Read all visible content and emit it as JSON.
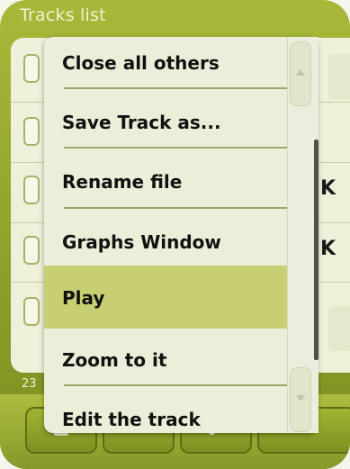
{
  "window": {
    "title": "Tracks list",
    "footer_count": "23",
    "right_text_1": "K",
    "right_text_2": "K"
  },
  "context_menu": {
    "items": [
      {
        "label": "Close all others",
        "selected": false
      },
      {
        "label": "Save Track as...",
        "selected": false
      },
      {
        "label": "Rename file",
        "selected": false
      },
      {
        "label": "Graphs Window",
        "selected": false
      },
      {
        "label": "Play",
        "selected": true
      },
      {
        "label": "Zoom to it",
        "selected": false
      },
      {
        "label": "Edit the track",
        "selected": false
      }
    ]
  },
  "toolbar": {
    "buttons": [
      {
        "icon": "list-icon"
      },
      {
        "icon": "menu-icon"
      },
      {
        "icon": "edit-pencil-icon"
      },
      {
        "icon": "forward-icon"
      }
    ]
  },
  "colors": {
    "frame_green": "#8fa12a",
    "menu_background": "#edeed9",
    "selected_highlight": "#c8cf72",
    "text": "#111111"
  }
}
